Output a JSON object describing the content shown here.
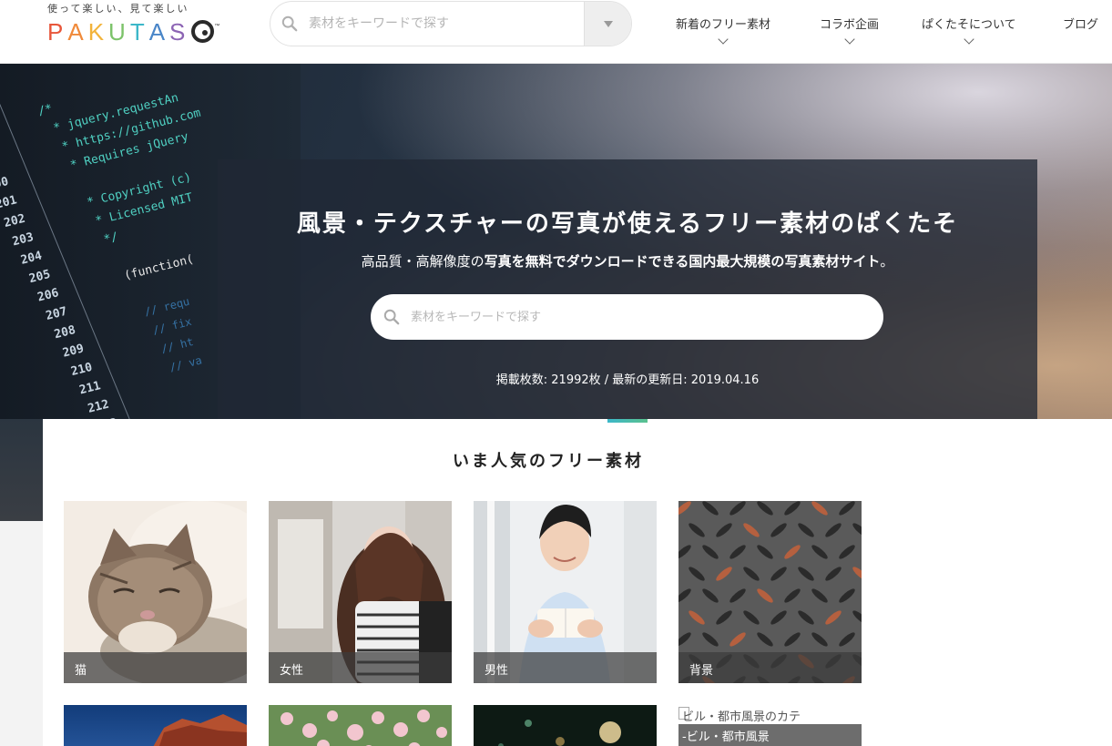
{
  "header": {
    "tagline": "使って楽しい、見て楽しい",
    "logo_letters": [
      "P",
      "A",
      "K",
      "U",
      "T",
      "A",
      "S"
    ],
    "logo_colors": [
      "#e8563a",
      "#f08a3a",
      "#f2b33a",
      "#7cc36a",
      "#3cb7c9",
      "#4a86c8",
      "#8c64b4"
    ],
    "logo_trademark": "™",
    "search_placeholder": "素材をキーワードで探す",
    "nav": [
      {
        "label": "新着のフリー素材",
        "has_dropdown": true
      },
      {
        "label": "コラボ企画",
        "has_dropdown": true
      },
      {
        "label": "ぱくたそについて",
        "has_dropdown": true
      },
      {
        "label": "ブログ",
        "has_dropdown": false
      }
    ]
  },
  "hero": {
    "title": "風景・テクスチャーの写真が使えるフリー素材のぱくたそ",
    "subtitle_prefix": "高品質・高解像度の",
    "subtitle_bold": "写真を無料でダウンロードできる国内最大規模の写真素材サイト",
    "subtitle_suffix": "。",
    "search_placeholder": "素材をキーワードで探す",
    "stats": "掲載枚数: 21992枚 / 最新の更新日: 2019.04.16"
  },
  "popular": {
    "title": "いま人気のフリー素材",
    "cards": [
      {
        "label": "猫"
      },
      {
        "label": "女性"
      },
      {
        "label": "男性"
      },
      {
        "label": "背景"
      }
    ],
    "broken_card": {
      "alt_text": "ビル・都市風景のカテ",
      "label": "-ビル・都市風景"
    }
  },
  "colors": {
    "accent_start": "#3cb7c9",
    "accent_end": "#5ac18e",
    "hero_panel": "#202834"
  }
}
